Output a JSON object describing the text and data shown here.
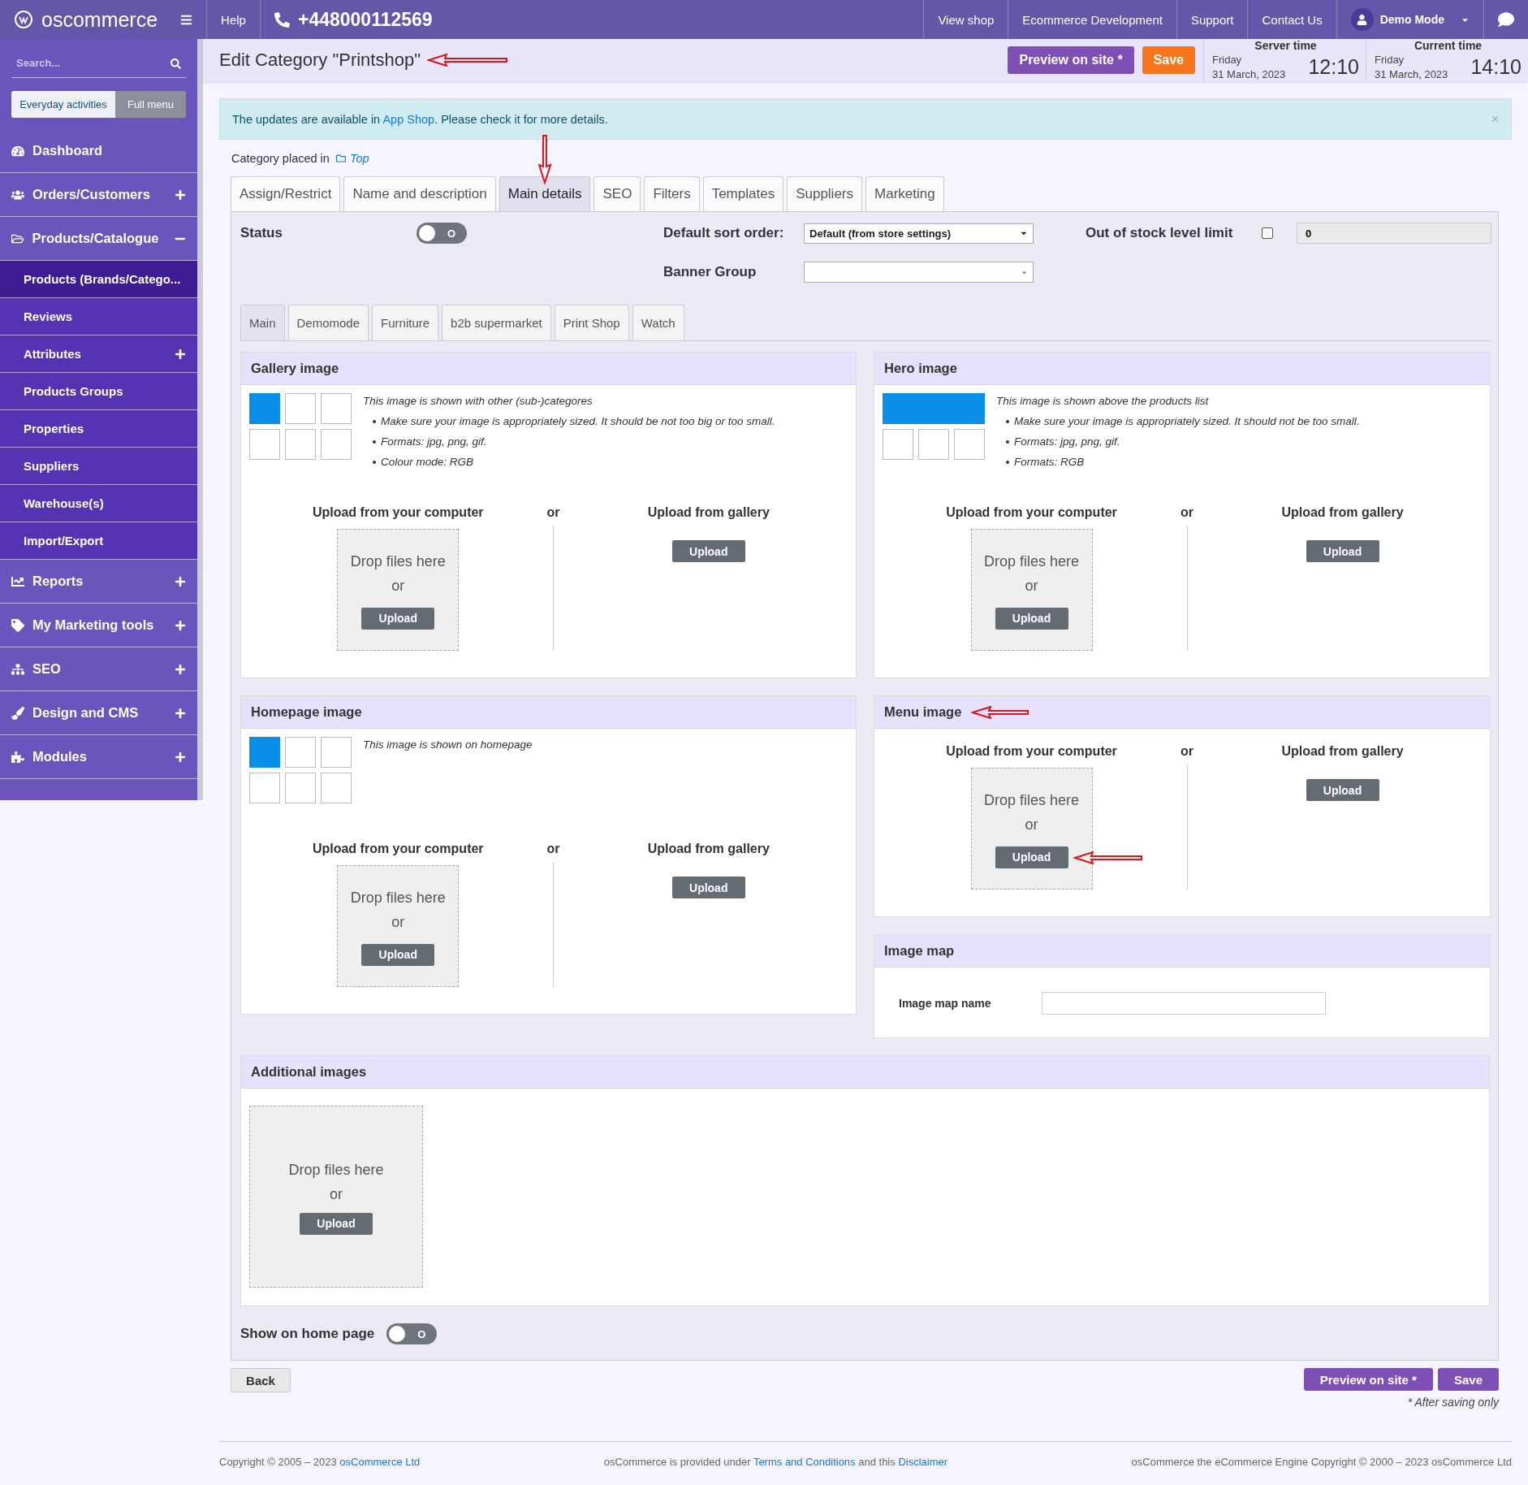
{
  "topbar": {
    "logo": "oscommerce",
    "help": "Help",
    "phone": "+448000112569",
    "links": [
      "View shop",
      "Ecommerce Development",
      "Support",
      "Contact Us"
    ],
    "user": "Demo Mode"
  },
  "sidebar": {
    "search": {
      "placeholder": "Search..."
    },
    "modes": [
      {
        "label": "Everyday activities",
        "selected": true
      },
      {
        "label": "Full menu",
        "selected": false
      }
    ],
    "items": [
      {
        "label": "Dashboard",
        "expandable": false,
        "expanded": false
      },
      {
        "label": "Orders/Customers",
        "expandable": true,
        "expanded": false
      },
      {
        "label": "Products/Catalogue",
        "expandable": true,
        "expanded": true,
        "children": [
          {
            "label": "Products (Brands/Catego...",
            "selected": true,
            "expandable": false
          },
          {
            "label": "Reviews",
            "selected": false,
            "expandable": false
          },
          {
            "label": "Attributes",
            "selected": false,
            "expandable": true
          },
          {
            "label": "Products Groups",
            "selected": false,
            "expandable": false
          },
          {
            "label": "Properties",
            "selected": false,
            "expandable": false
          },
          {
            "label": "Suppliers",
            "selected": false,
            "expandable": false
          },
          {
            "label": "Warehouse(s)",
            "selected": false,
            "expandable": false
          },
          {
            "label": "Import/Export",
            "selected": false,
            "expandable": false
          }
        ]
      },
      {
        "label": "Reports",
        "expandable": true,
        "expanded": false
      },
      {
        "label": "My Marketing tools",
        "expandable": true,
        "expanded": false
      },
      {
        "label": "SEO",
        "expandable": true,
        "expanded": false
      },
      {
        "label": "Design and CMS",
        "expandable": true,
        "expanded": false
      },
      {
        "label": "Modules",
        "expandable": true,
        "expanded": false
      }
    ]
  },
  "header": {
    "title": "Edit Category \"Printshop\"",
    "marked": true,
    "buttons": [
      {
        "label": "Preview on site *",
        "kind": "preview"
      },
      {
        "label": "Save",
        "kind": "save"
      }
    ],
    "clocks": [
      {
        "label": "Server time",
        "day": "Friday",
        "date": "31 March, 2023",
        "time": "12:10"
      },
      {
        "label": "Current time",
        "day": "Friday",
        "date": "31 March, 2023",
        "time": "14:10"
      }
    ]
  },
  "alert": {
    "text_before": "The updates are available in ",
    "link": "App Shop",
    "text_after": ". Please check it for more details.",
    "close": "×"
  },
  "breadcrumb": {
    "label": "Category placed in",
    "link": "Top"
  },
  "tabs": [
    {
      "label": "Assign/Restrict",
      "selected": false,
      "marked": false
    },
    {
      "label": "Name and description",
      "selected": false,
      "marked": false
    },
    {
      "label": "Main details",
      "selected": true,
      "marked": true
    },
    {
      "label": "SEO",
      "selected": false,
      "marked": false
    },
    {
      "label": "Filters",
      "selected": false,
      "marked": false
    },
    {
      "label": "Templates",
      "selected": false,
      "marked": false
    },
    {
      "label": "Suppliers",
      "selected": false,
      "marked": false
    },
    {
      "label": "Marketing",
      "selected": false,
      "marked": false
    }
  ],
  "fields": {
    "status": {
      "label": "Status",
      "on": false,
      "toggle_text": "O"
    },
    "sort_order": {
      "label": "Default sort order:",
      "value": "Default (from store settings)"
    },
    "banner_group": {
      "label": "Banner Group"
    },
    "stock_limit": {
      "label": "Out of stock level limit",
      "checked": false,
      "value": "0"
    }
  },
  "subtabs": [
    {
      "label": "Main",
      "selected": true
    },
    {
      "label": "Demomode",
      "selected": false
    },
    {
      "label": "Furniture",
      "selected": false
    },
    {
      "label": "b2b supermarket",
      "selected": false
    },
    {
      "label": "Print Shop",
      "selected": false
    },
    {
      "label": "Watch",
      "selected": false
    }
  ],
  "panels": {
    "left": [
      {
        "kind": "image",
        "title": "Gallery image",
        "marked": false,
        "thumbnails": [
          {
            "kind": "square",
            "selected": true
          },
          {
            "kind": "square",
            "selected": false
          },
          {
            "kind": "square",
            "selected": false
          },
          {
            "kind": "square",
            "selected": false
          },
          {
            "kind": "square",
            "selected": false
          },
          {
            "kind": "square",
            "selected": false
          }
        ],
        "description": "This image is shown with other (sub-)categores",
        "bullets": [
          "Make sure your image is appropriately sized. It should be not too big or too small.",
          "Formats: jpg, png, gif.",
          "Colour mode: RGB"
        ],
        "upload": {
          "computer_label": "Upload from your computer",
          "or": "or",
          "gallery_label": "Upload from gallery",
          "drop_text": "Drop files here",
          "drop_or": "or",
          "upload_button": "Upload",
          "gallery_button": "Upload"
        }
      },
      {
        "kind": "image",
        "title": "Homepage image",
        "marked": false,
        "thumbnails": [
          {
            "kind": "square",
            "selected": true
          },
          {
            "kind": "square",
            "selected": false
          },
          {
            "kind": "square",
            "selected": false
          },
          {
            "kind": "square",
            "selected": false
          },
          {
            "kind": "square",
            "selected": false
          },
          {
            "kind": "square",
            "selected": false
          }
        ],
        "description": "This image is shown on homepage",
        "upload": {
          "computer_label": "Upload from your computer",
          "or": "or",
          "gallery_label": "Upload from gallery",
          "drop_text": "Drop files here",
          "drop_or": "or",
          "upload_button": "Upload",
          "gallery_button": "Upload"
        }
      }
    ],
    "right": [
      {
        "kind": "image",
        "title": "Hero image",
        "marked": false,
        "thumbnails": [
          {
            "kind": "wide",
            "selected": true
          },
          {
            "kind": "square",
            "selected": false
          },
          {
            "kind": "square",
            "selected": false
          },
          {
            "kind": "square",
            "selected": false
          }
        ],
        "description": "This image is shown above the products list",
        "bullets": [
          "Make sure your image is appropriately sized. It should not be too small.",
          "Formats: jpg, png, gif.",
          "Formats: RGB"
        ],
        "upload": {
          "computer_label": "Upload from your computer",
          "or": "or",
          "gallery_label": "Upload from gallery",
          "drop_text": "Drop files here",
          "drop_or": "or",
          "upload_button": "Upload",
          "gallery_button": "Upload"
        }
      },
      {
        "kind": "image",
        "title": "Menu image",
        "marked": true,
        "upload": {
          "computer_label": "Upload from your computer",
          "or": "or",
          "gallery_label": "Upload from gallery",
          "drop_text": "Drop files here",
          "drop_or": "or",
          "upload_button": "Upload",
          "gallery_button": "Upload"
        }
      },
      {
        "kind": "image_map",
        "title": "Image map",
        "field_label": "Image map name"
      }
    ]
  },
  "additional": {
    "title": "Additional images",
    "drop_text": "Drop files here",
    "drop_or": "or",
    "upload_button": "Upload"
  },
  "show_home": {
    "label": "Show on home page",
    "on": false,
    "toggle_text": "O"
  },
  "bottom": {
    "back": "Back",
    "buttons": [
      "Preview on site *",
      "Save"
    ],
    "note": "* After saving only"
  },
  "footer": {
    "left_text": "Copyright © 2005 – 2023 ",
    "left_link": "osCommerce Ltd",
    "center_before": "osCommerce is provided under ",
    "center_link1": "Terms and Conditions",
    "center_mid": " and this ",
    "center_link2": "Disclaimer",
    "right": "osCommerce the eCommerce Engine Copyright © 2000 – 2023 osCommerce Ltd"
  }
}
